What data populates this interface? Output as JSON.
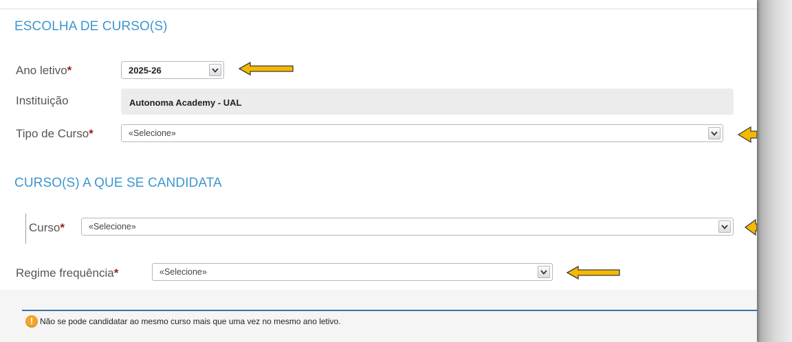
{
  "sections": {
    "escolha_title": "ESCOLHA DE CURSO(S)",
    "candidata_title": "CURSO(S) A QUE SE CANDIDATA"
  },
  "required_marker": "*",
  "fields": {
    "ano_letivo": {
      "label": "Ano letivo",
      "value": "2025-26"
    },
    "instituicao": {
      "label": "Instituição",
      "value": "Autonoma Academy - UAL"
    },
    "tipo_curso": {
      "label": "Tipo de Curso",
      "value": "«Selecione»"
    },
    "curso": {
      "label": "Curso",
      "value": "«Selecione»"
    },
    "regime_frequencia": {
      "label": "Regime frequência",
      "value": "«Selecione»"
    }
  },
  "notice": {
    "icon": "!",
    "text": "Não se pode candidatar ao mesmo curso mais que uma vez no mesmo ano letivo."
  },
  "colors": {
    "section_title": "#3b97cf",
    "required": "#9b1b1b",
    "arrow_fill": "#f5b800",
    "arrow_stroke": "#3a3a3a",
    "notice_icon": "#f2a72a",
    "info_line": "#3d6f9e"
  },
  "icons": {
    "dropdown": "chevron-down-icon",
    "annotation": "left-arrow-icon",
    "warning": "warning-icon"
  }
}
